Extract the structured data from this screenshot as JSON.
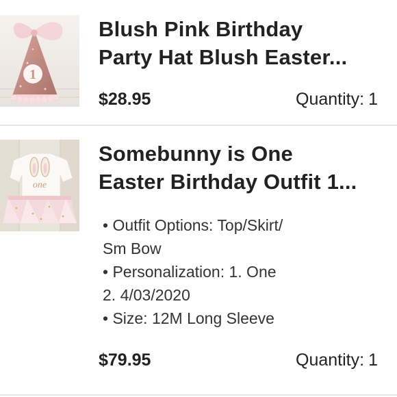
{
  "items": [
    {
      "title_lines": [
        "Blush Pink Birthday",
        "Party Hat Blush Easter..."
      ],
      "price": "$28.95",
      "quantity_label": "Quantity:",
      "quantity_value": "1",
      "image": "glitter-party-hat-photo",
      "image_number": "1"
    },
    {
      "title_lines": [
        "Somebunny is One",
        "Easter Birthday Outfit 1..."
      ],
      "price": "$79.95",
      "quantity_label": "Quantity:",
      "quantity_value": "1",
      "image": "bunny-outfit-tutu-photo",
      "image_text": "one",
      "options": [
        "• Outfit Options: Top/Skirt/",
        "Sm Bow",
        "• Personalization:  1. One",
        "2. 4/03/2020",
        "• Size: 12M Long Sleeve"
      ]
    }
  ],
  "colors": {
    "text": "#222222",
    "divider": "#e6e6e6",
    "blush_pink": "#f2c9cd",
    "rose_gold": "#c9948a"
  }
}
